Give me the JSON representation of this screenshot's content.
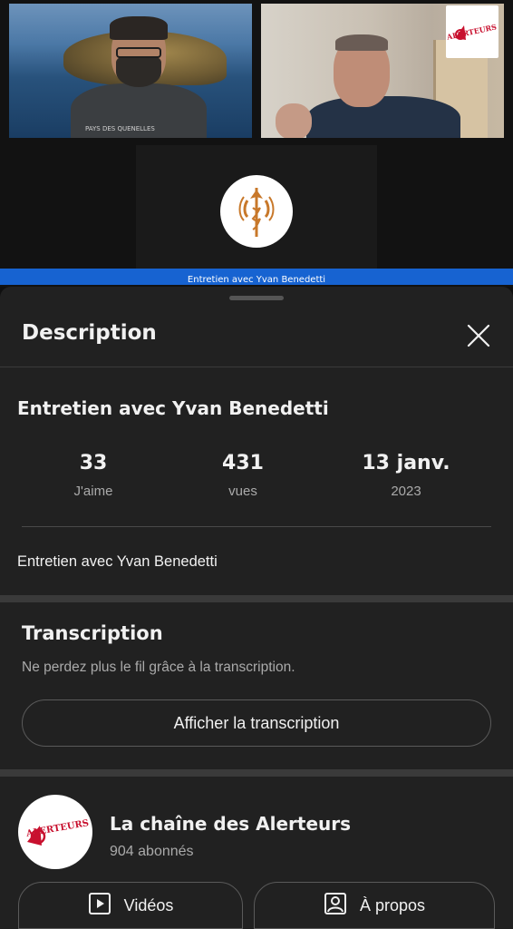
{
  "video": {
    "caption": "Entretien avec Yvan Benedetti",
    "shirt_text": "PAYS DES QUENELLES",
    "logo_text": "ALERTEURS"
  },
  "sheet": {
    "title": "Description",
    "close_icon": "close-icon"
  },
  "details": {
    "title": "Entretien avec Yvan Benedetti",
    "likes": {
      "value": "33",
      "label": "J'aime"
    },
    "views": {
      "value": "431",
      "label": "vues"
    },
    "date": {
      "value": "13 janv.",
      "label": "2023"
    },
    "description": "Entretien avec Yvan Benedetti"
  },
  "transcription": {
    "title": "Transcription",
    "subtitle": "Ne perdez plus le fil grâce à la transcription.",
    "button_label": "Afficher la transcription"
  },
  "channel": {
    "name": "La chaîne des Alerteurs",
    "subscribers": "904 abonnés",
    "avatar_text": "ALERTEURS",
    "videos_label": "Vidéos",
    "videos_icon": "play-box-icon",
    "about_label": "À propos",
    "about_icon": "person-box-icon"
  },
  "colors": {
    "background": "#0f0f0f",
    "sheet": "#212121",
    "caption_bar": "#1763d1",
    "secondary_text": "#aaaaaa"
  }
}
